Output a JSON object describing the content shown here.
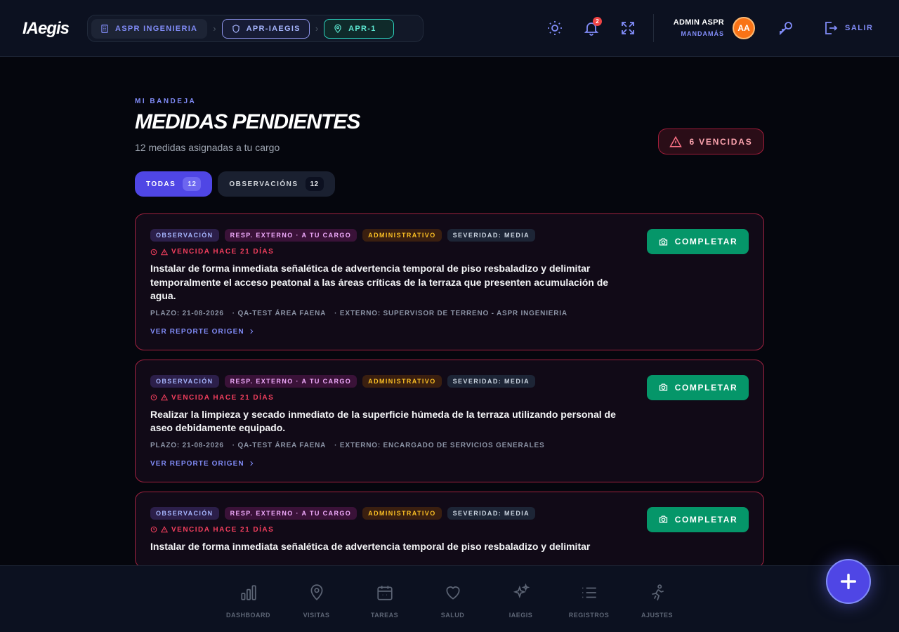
{
  "app": {
    "logo": "IAegis"
  },
  "breadcrumb": [
    {
      "label": "ASPR INGENIERIA",
      "icon": "building-icon"
    },
    {
      "label": "APR-IAEGIS",
      "icon": "shield-icon"
    },
    {
      "label": "APR-1",
      "icon": "map-pin-icon"
    }
  ],
  "header": {
    "notifications_count": "2",
    "user_name": "ADMIN ASPR",
    "user_role": "MANDAMÁS",
    "avatar_initials": "AA",
    "logout_label": "SALIR"
  },
  "page": {
    "eyebrow": "MI BANDEJA",
    "title": "MEDIDAS PENDIENTES",
    "subtitle": "12 medidas asignadas a tu cargo",
    "overdue_label": "6 VENCIDAS"
  },
  "tabs": [
    {
      "label": "TODAS",
      "count": "12",
      "active": true
    },
    {
      "label": "OBSERVACIÓNS",
      "count": "12",
      "active": false
    }
  ],
  "cards": [
    {
      "chips": [
        "OBSERVACIÓN",
        "RESP. EXTERNO · A TU CARGO",
        "ADMINISTRATIVO",
        "SEVERIDAD: MEDIA"
      ],
      "due": "VENCIDA HACE 21 DÍAS",
      "text": "Instalar de forma inmediata señalética de advertencia temporal de piso resbaladizo y delimitar temporalmente el acceso peatonal a las áreas críticas de la terraza que presenten acumulación de agua.",
      "meta": [
        "PLAZO: 21-08-2026",
        "· QA-TEST ÁREA FAENA",
        "· EXTERNO: SUPERVISOR DE TERRENO - ASPR INGENIERIA"
      ],
      "link": "VER REPORTE ORIGEN",
      "action": "COMPLETAR"
    },
    {
      "chips": [
        "OBSERVACIÓN",
        "RESP. EXTERNO · A TU CARGO",
        "ADMINISTRATIVO",
        "SEVERIDAD: MEDIA"
      ],
      "due": "VENCIDA HACE 21 DÍAS",
      "text": "Realizar la limpieza y secado inmediato de la superficie húmeda de la terraza utilizando personal de aseo debidamente equipado.",
      "meta": [
        "PLAZO: 21-08-2026",
        "· QA-TEST ÁREA FAENA",
        "· EXTERNO: ENCARGADO DE SERVICIOS GENERALES"
      ],
      "link": "VER REPORTE ORIGEN",
      "action": "COMPLETAR"
    },
    {
      "chips": [
        "OBSERVACIÓN",
        "RESP. EXTERNO · A TU CARGO",
        "ADMINISTRATIVO",
        "SEVERIDAD: MEDIA"
      ],
      "due": "VENCIDA HACE 21 DÍAS",
      "text": "Instalar de forma inmediata señalética de advertencia temporal de piso resbaladizo y delimitar",
      "meta": [],
      "link": "",
      "action": "COMPLETAR"
    }
  ],
  "bottom_nav": [
    {
      "label": "DASHBOARD",
      "icon": "bar-chart-icon"
    },
    {
      "label": "VISITAS",
      "icon": "map-pin-icon"
    },
    {
      "label": "TAREAS",
      "icon": "calendar-icon"
    },
    {
      "label": "SALUD",
      "icon": "heart-icon"
    },
    {
      "label": "IAEGIS",
      "icon": "sparkles-icon"
    },
    {
      "label": "REGISTROS",
      "icon": "list-icon"
    },
    {
      "label": "AJUSTES",
      "icon": "runner-icon"
    }
  ],
  "colors": {
    "accent": "#4f46e5",
    "danger": "#f43f5e",
    "success": "#059669",
    "background": "#05060d"
  }
}
